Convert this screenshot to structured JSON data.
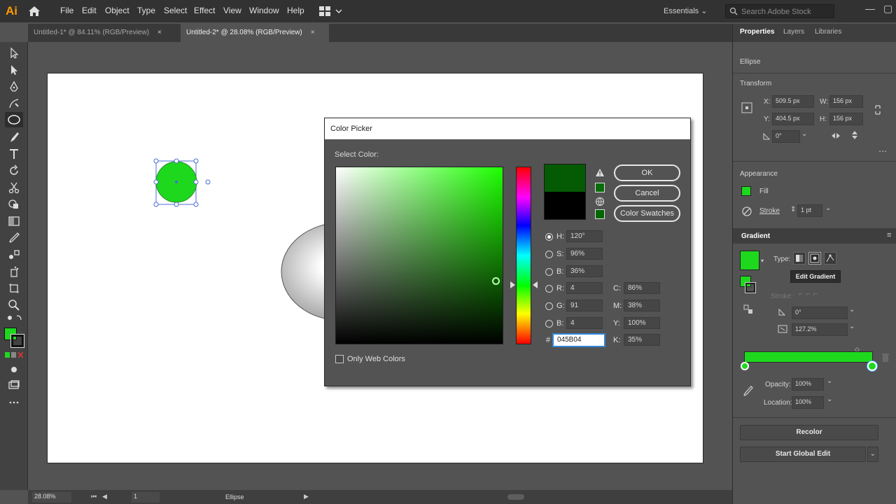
{
  "app": {
    "logo": "Ai"
  },
  "menu": [
    "File",
    "Edit",
    "Object",
    "Type",
    "Select",
    "Effect",
    "View",
    "Window",
    "Help"
  ],
  "workspace": "Essentials",
  "stock_search": {
    "placeholder": "Search Adobe Stock"
  },
  "tabs": [
    {
      "label": "Untitled-1* @ 84.11% (RGB/Preview)",
      "active": false
    },
    {
      "label": "Untitled-2* @ 28.08% (RGB/Preview)",
      "active": true
    }
  ],
  "tab_close": "×",
  "color_picker": {
    "title": "Color Picker",
    "select_label": "Select Color:",
    "buttons": {
      "ok": "OK",
      "cancel": "Cancel",
      "swatches": "Color Swatches"
    },
    "fields": {
      "H": {
        "label": "H:",
        "value": "120°"
      },
      "S": {
        "label": "S:",
        "value": "96%"
      },
      "B": {
        "label": "B:",
        "value": "36%"
      },
      "R": {
        "label": "R:",
        "value": "4"
      },
      "G": {
        "label": "G:",
        "value": "91"
      },
      "Bl": {
        "label": "B:",
        "value": "4"
      },
      "C": {
        "label": "C:",
        "value": "86%"
      },
      "M": {
        "label": "M:",
        "value": "38%"
      },
      "Y": {
        "label": "Y:",
        "value": "100%"
      },
      "K": {
        "label": "K:",
        "value": "35%"
      }
    },
    "hex_label": "#",
    "hex_value": "045B04",
    "only_web_colors": "Only Web Colors",
    "new_color": "#045b04",
    "old_color": "#000000"
  },
  "panel": {
    "tabs": [
      "Properties",
      "Layers",
      "Libraries"
    ],
    "selection": "Ellipse",
    "transform_label": "Transform",
    "x_label": "X:",
    "x": "509.5 px",
    "y_label": "Y:",
    "y": "404.5 px",
    "w_label": "W:",
    "w": "156 px",
    "h_label": "H:",
    "h": "156 px",
    "rotate": "0°",
    "appearance_label": "Appearance",
    "fill_label": "Fill",
    "stroke_label": "Stroke",
    "stroke_weight": "1 pt",
    "gradient_tab": "Gradient",
    "type_label": "Type:",
    "edit_gradient": "Edit Gradient",
    "stroke_row_label": "Stroke:",
    "angle": "0°",
    "aspect": "127.2%",
    "opacity_label": "Opacity:",
    "opacity": "100%",
    "location_label": "Location:",
    "location": "100%",
    "recolor": "Recolor",
    "global_edit": "Start Global Edit"
  },
  "status": {
    "zoom": "28.08%",
    "page": "1",
    "tool": "Ellipse"
  },
  "colors": {
    "accent_green": "#1ed81e",
    "dark_green": "#045b04",
    "selection_blue": "#4a6cd4"
  }
}
